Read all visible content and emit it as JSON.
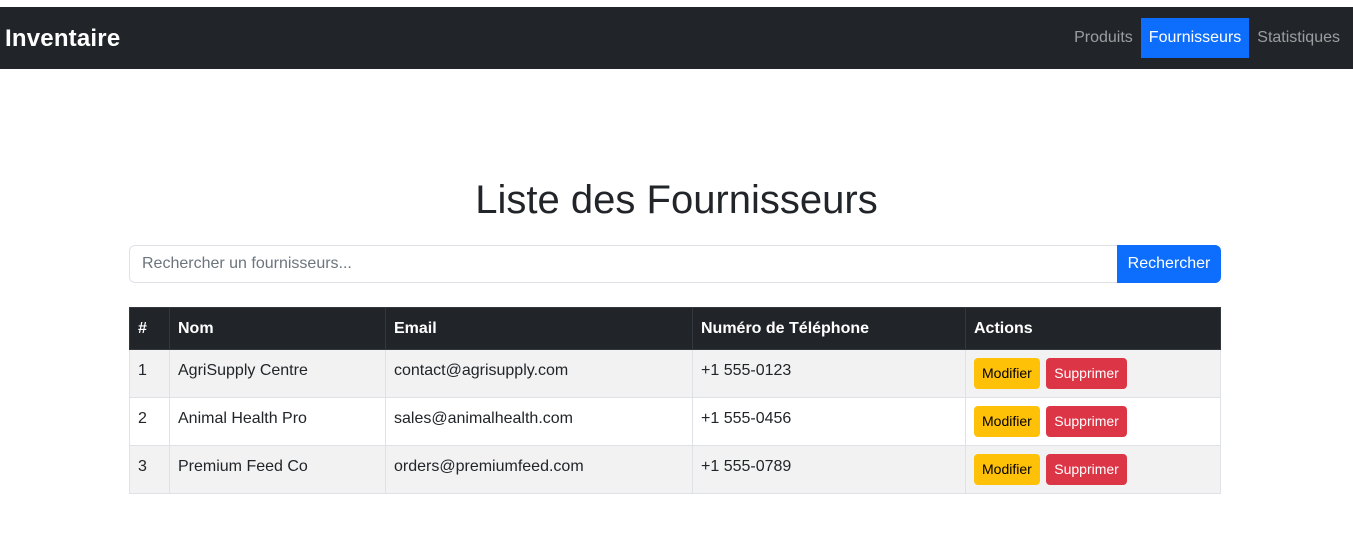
{
  "navbar": {
    "brand": "Inventaire",
    "links": [
      {
        "label": "Produits",
        "active": false
      },
      {
        "label": "Fournisseurs",
        "active": true
      },
      {
        "label": "Statistiques",
        "active": false
      }
    ]
  },
  "page": {
    "title": "Liste des Fournisseurs"
  },
  "search": {
    "placeholder": "Rechercher un fournisseurs...",
    "value": "",
    "button_label": "Rechercher"
  },
  "table": {
    "headers": {
      "index": "#",
      "name": "Nom",
      "email": "Email",
      "phone": "Numéro de Téléphone",
      "actions": "Actions"
    },
    "rows": [
      {
        "index": "1",
        "name": "AgriSupply Centre",
        "email": "contact@agrisupply.com",
        "phone": "+1 555-0123",
        "edit_label": "Modifier",
        "delete_label": "Supprimer"
      },
      {
        "index": "2",
        "name": "Animal Health Pro",
        "email": "sales@animalhealth.com",
        "phone": "+1 555-0456",
        "edit_label": "Modifier",
        "delete_label": "Supprimer"
      },
      {
        "index": "3",
        "name": "Premium Feed Co",
        "email": "orders@premiumfeed.com",
        "phone": "+1 555-0789",
        "edit_label": "Modifier",
        "delete_label": "Supprimer"
      }
    ]
  },
  "colors": {
    "navbar_bg": "#212529",
    "accent": "#0d6efd",
    "edit_button": "#ffc107",
    "delete_button": "#dc3545"
  }
}
